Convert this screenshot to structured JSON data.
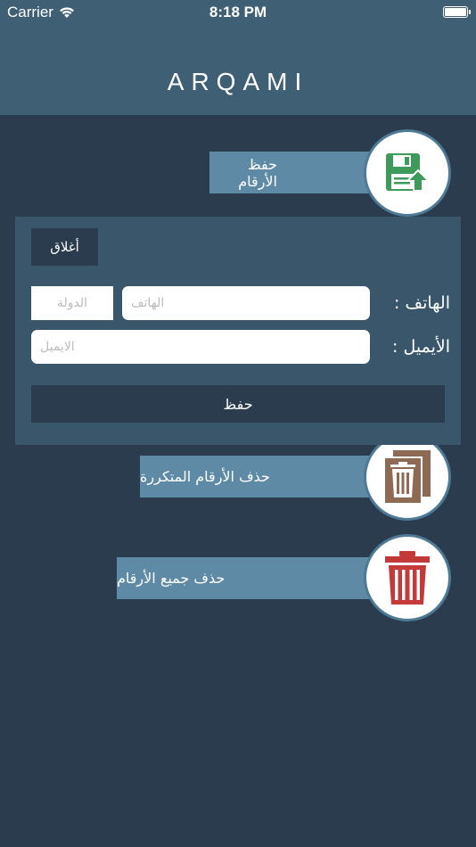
{
  "status_bar": {
    "carrier": "Carrier",
    "time": "8:18 PM"
  },
  "header": {
    "title": "ARQAMI"
  },
  "actions": {
    "save_numbers": {
      "label": "حفظ الأرقام",
      "icon": "floppy-upload-icon",
      "icon_color": "#3e9a5a"
    },
    "delete_duplicates": {
      "label": "حذف الأرقام المتكررة",
      "icon": "duplicate-trash-icon",
      "icon_color": "#8e6a55"
    },
    "delete_all": {
      "label": "حذف جميع الأرقام",
      "icon": "trash-icon",
      "icon_color": "#c43a3a"
    }
  },
  "form": {
    "close_label": "أغلاق",
    "phone_label": "الهاتف :",
    "phone_placeholder": "الهاتف",
    "phone_value": "",
    "country_placeholder": "الدولة",
    "country_value": "",
    "email_label": "الأيميل :",
    "email_placeholder": "الايميل",
    "email_value": "",
    "save_label": "حفظ"
  },
  "colors": {
    "background": "#2a3c4d",
    "header": "#3f5f74",
    "action_bar": "#5f8aa5",
    "panel": "#3a566b"
  }
}
